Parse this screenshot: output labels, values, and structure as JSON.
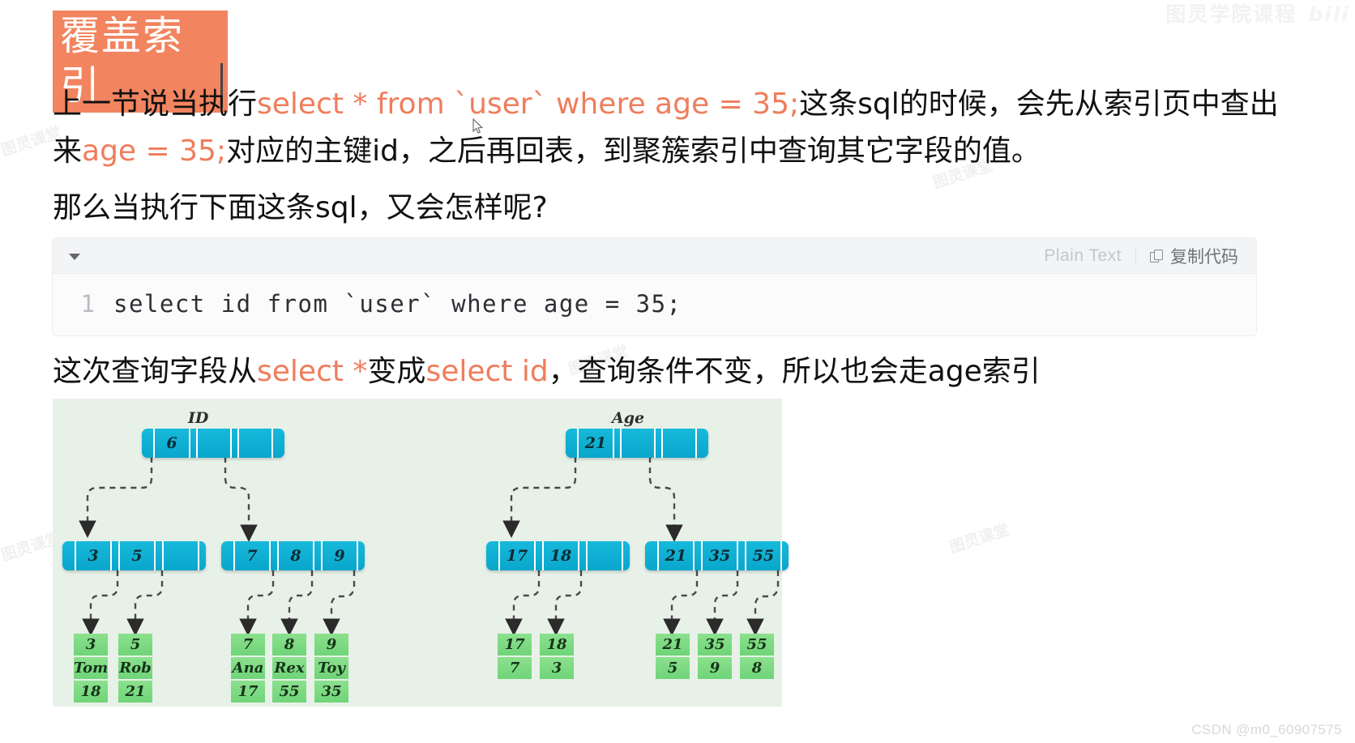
{
  "heading": {
    "text": "覆盖索引",
    "bg_color": "#f2845f",
    "text_color": "#ffffff"
  },
  "paragraphs": {
    "p1_a": "上一节说当执行",
    "p1_sql1": "select *  from `user` where age = 35;",
    "p1_b": "这条sql的时候，会先从索引页中查出来",
    "p1_sql2": "age = 35;",
    "p1_c": "对应的主键id，之后再回表，到聚簇索引中查询其它字段的值。",
    "p2": "那么当执行下面这条sql，又会怎样呢?",
    "p3_a": "这次查询字段从",
    "p3_sql1": "select *",
    "p3_b": "变成",
    "p3_sql2": "select id",
    "p3_c": "，查询条件不变，所以也会走age索引",
    "sql_color": "#ef7d5c"
  },
  "code_block": {
    "language_label": "Plain Text",
    "copy_label": "复制代码",
    "line_number": "1",
    "code": "select id from `user` where age = 35;"
  },
  "diagram": {
    "bg_color": "#e7f1e8",
    "node_color": "#09a6cb",
    "leaf_color": "#6fd478",
    "trees": [
      {
        "label": "ID",
        "root": {
          "cells": [
            "6",
            "",
            "",
            "",
            ""
          ]
        },
        "internal": [
          {
            "cells": [
              "3",
              "5",
              "",
              ""
            ]
          },
          {
            "cells": [
              "7",
              "8",
              "9",
              ""
            ]
          }
        ],
        "leaves": [
          {
            "rows": [
              "3",
              "Tom",
              "18"
            ]
          },
          {
            "rows": [
              "5",
              "Rob",
              "21"
            ]
          },
          {
            "rows": [
              "7",
              "Ana",
              "17"
            ]
          },
          {
            "rows": [
              "8",
              "Rex",
              "55"
            ]
          },
          {
            "rows": [
              "9",
              "Toy",
              "35"
            ]
          }
        ]
      },
      {
        "label": "Age",
        "root": {
          "cells": [
            "21",
            "",
            "",
            "",
            ""
          ]
        },
        "internal": [
          {
            "cells": [
              "17",
              "18",
              "",
              ""
            ]
          },
          {
            "cells": [
              "21",
              "35",
              "55",
              ""
            ]
          }
        ],
        "leaves": [
          {
            "rows": [
              "17",
              "7"
            ]
          },
          {
            "rows": [
              "18",
              "3"
            ]
          },
          {
            "rows": [
              "21",
              "5"
            ]
          },
          {
            "rows": [
              "35",
              "9"
            ]
          },
          {
            "rows": [
              "55",
              "8"
            ]
          }
        ]
      }
    ]
  },
  "watermarks": {
    "top_right": "图灵学院课程",
    "bilibili": "bili",
    "bottom_right": "CSDN @m0_60907575",
    "faint": "图灵课堂"
  }
}
